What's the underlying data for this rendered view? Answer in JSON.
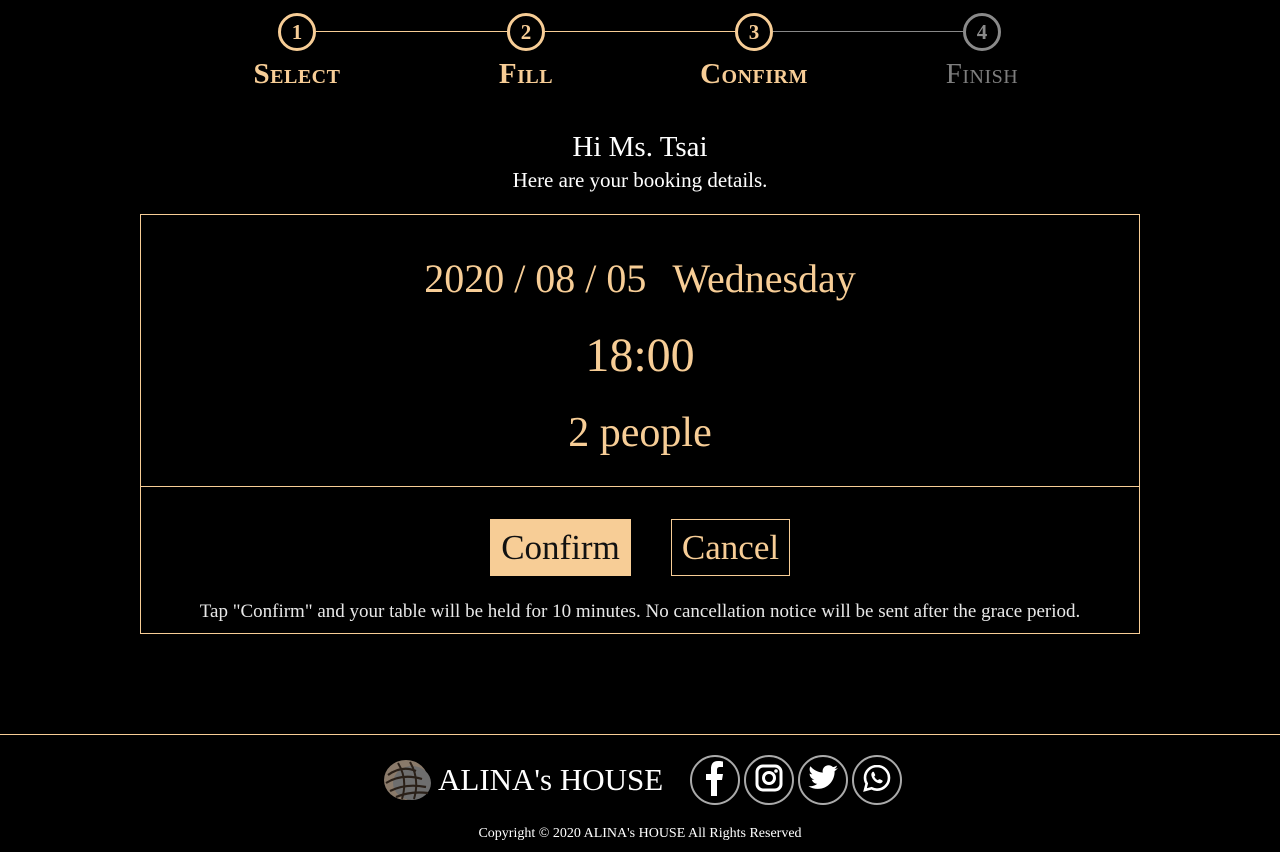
{
  "stepper": {
    "steps": [
      {
        "number": "1",
        "label": "Select",
        "state": "done"
      },
      {
        "number": "2",
        "label": "Fill",
        "state": "done"
      },
      {
        "number": "3",
        "label": "Confirm",
        "state": "current"
      },
      {
        "number": "4",
        "label": "Finish",
        "state": "upcoming"
      }
    ]
  },
  "greeting": {
    "title": "Hi Ms. Tsai",
    "subtitle": "Here are your booking details."
  },
  "booking": {
    "date": "2020 / 08 / 05",
    "weekday": "Wednesday",
    "time": "18:00",
    "party_size": "2 people"
  },
  "actions": {
    "confirm_label": "Confirm",
    "cancel_label": "Cancel",
    "note": "Tap \"Confirm\" and your table will be held for 10 minutes. No cancellation notice will be sent after the grace period."
  },
  "footer": {
    "brand_name": "ALINA's HOUSE",
    "social_links": [
      {
        "icon": "facebook-icon"
      },
      {
        "icon": "instagram-icon"
      },
      {
        "icon": "twitter-icon"
      },
      {
        "icon": "whatsapp-icon"
      }
    ],
    "copyright": "Copyright © 2020 ALINA's HOUSE All Rights Reserved"
  },
  "colors": {
    "accent": "#f7cd96",
    "background": "#000000",
    "inactive": "#8a8a8a"
  }
}
